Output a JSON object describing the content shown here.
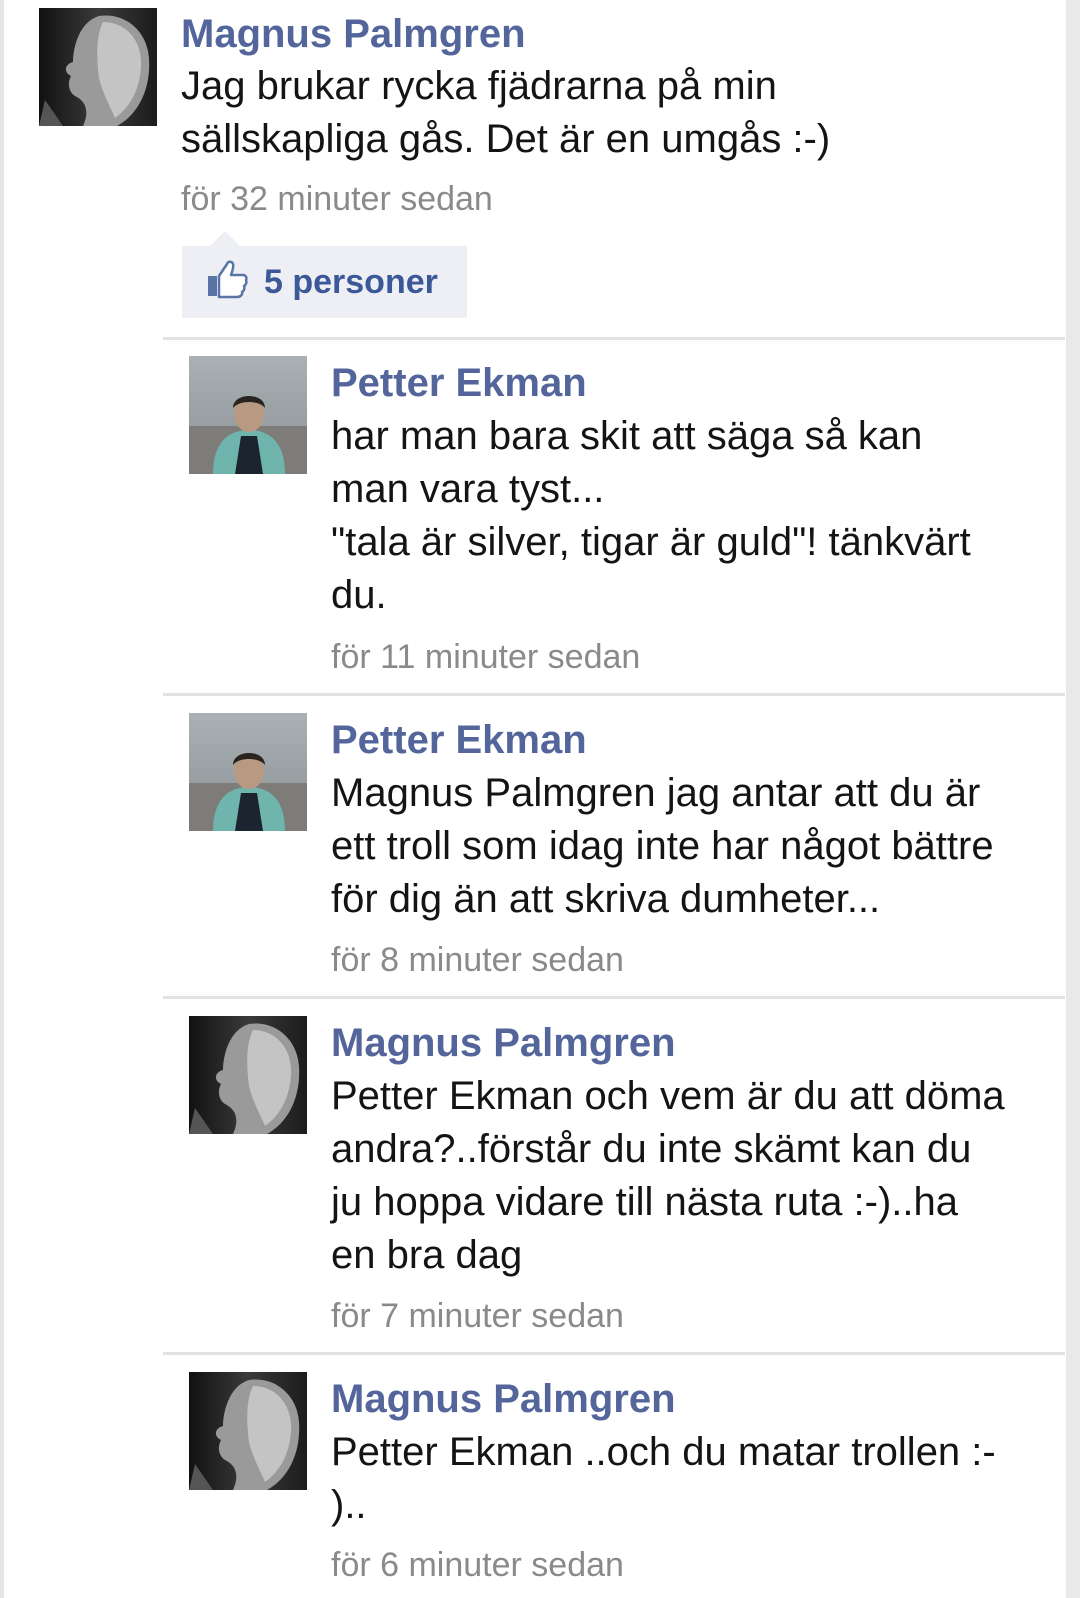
{
  "post": {
    "author": "Magnus Palmgren",
    "text": "Jag brukar rycka fjädrarna på min\nsällskapliga gås. Det är en umgås :-)",
    "time": "för 32 minuter sedan",
    "likes_label": "5 personer",
    "avatar_icon": "profile-photo-magnus"
  },
  "comments": [
    {
      "author": "Petter Ekman",
      "text": "har man bara skit att säga så kan\nman vara tyst...\n\"tala är silver, tigar är guld\"! tänkvärt\ndu.",
      "time": "för 11 minuter sedan",
      "avatar_icon": "profile-photo-petter"
    },
    {
      "author": "Petter Ekman",
      "text": "Magnus Palmgren jag antar att du är\nett troll som idag inte har något bättre\nför dig än att skriva dumheter...",
      "time": "för 8 minuter sedan",
      "avatar_icon": "profile-photo-petter"
    },
    {
      "author": "Magnus Palmgren",
      "text": "Petter Ekman och vem är du att döma\nandra?..förstår du inte skämt kan du\nju hoppa vidare till nästa ruta :-)..ha\nen bra dag",
      "time": "för 7 minuter sedan",
      "avatar_icon": "profile-photo-magnus"
    },
    {
      "author": "Magnus Palmgren",
      "text": "Petter Ekman ..och du matar trollen :-\n)..",
      "time": "för 6 minuter sedan",
      "avatar_icon": "profile-photo-magnus"
    }
  ],
  "colors": {
    "name": "#53659a",
    "likes": "#3b5998",
    "likes_bg": "#edeff4",
    "timestamp": "#8a8a8a",
    "text": "#141414"
  }
}
